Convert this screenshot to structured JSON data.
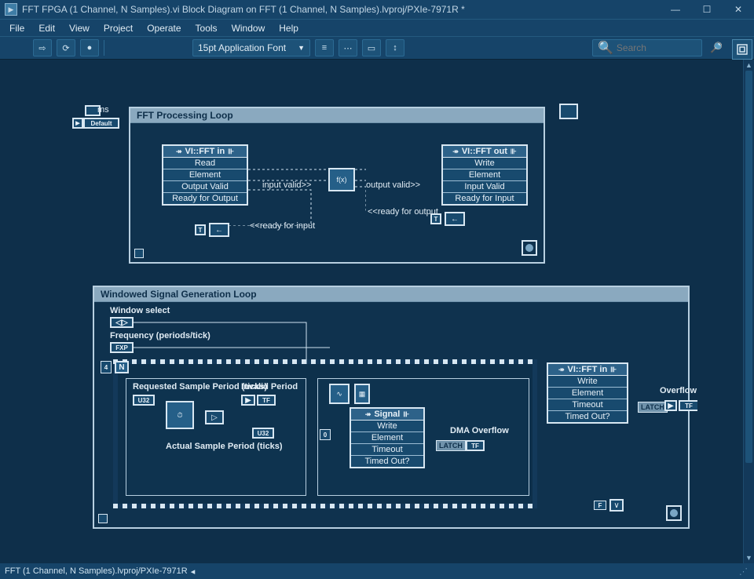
{
  "window": {
    "title": "FFT FPGA (1 Channel, N Samples).vi Block Diagram on FFT (1 Channel, N Samples).lvproj/PXIe-7971R *",
    "min_glyph": "—",
    "max_glyph": "☐",
    "close_glyph": "✕"
  },
  "menu": [
    "File",
    "Edit",
    "View",
    "Project",
    "Operate",
    "Tools",
    "Window",
    "Help"
  ],
  "toolbar": {
    "run_glyph": "⇨",
    "runloop_glyph": "⟳",
    "abort_glyph": "●",
    "font_label": "15pt Application Font",
    "align_glyph": "≡",
    "distribute_glyph": "⋯",
    "resize_glyph": "▭",
    "reorder_glyph": "↕",
    "search_placeholder": "Search",
    "search_glyph": "🔍",
    "help_glyph": "?"
  },
  "loop1": {
    "title": "FFT Processing Loop",
    "ms_label": "ms",
    "default_label": "Default",
    "fifo_in": {
      "header": "VI::FFT in",
      "rows": [
        "Read",
        "Element",
        "Output Valid",
        "Ready for Output"
      ]
    },
    "fifo_out": {
      "header": "VI::FFT out",
      "rows": [
        "Write",
        "Element",
        "Input Valid",
        "Ready for Input"
      ]
    },
    "lbl_input_valid": "input valid>>",
    "lbl_output_valid": "output valid>>",
    "lbl_ready_output": "<<ready for output",
    "lbl_ready_input": "<<ready for input",
    "fxp_glyph": "f(x)",
    "fb_glyph": "←",
    "bool_t": "T"
  },
  "loop2": {
    "title": "Windowed Signal Generation Loop",
    "window_select": "Window select",
    "freq": "Frequency (periods/tick)",
    "fxp_term": "FXP",
    "u32_term": "U32",
    "tf_term": "TF",
    "n_glyph": "N",
    "four_glyph": "4",
    "zero_glyph": "0",
    "req_period": "Requested Sample Period (ticks)",
    "act_period": "Actual Sample Period (ticks)",
    "invalid_period": "Invalid Period",
    "signal_header": "Signal",
    "signal_rows": [
      "Write",
      "Element",
      "Timeout",
      "Timed Out?"
    ],
    "dma_overflow": "DMA Overflow",
    "latch": "LATCH",
    "fftin_header": "VI::FFT in",
    "fftin_rows": [
      "Write",
      "Element",
      "Timeout",
      "Timed Out?"
    ],
    "overflow": "Overflow",
    "sine_glyph": "∿",
    "cmp_glyph": "▷"
  },
  "status": {
    "text": "FFT (1 Channel, N Samples).lvproj/PXIe-7971R"
  }
}
